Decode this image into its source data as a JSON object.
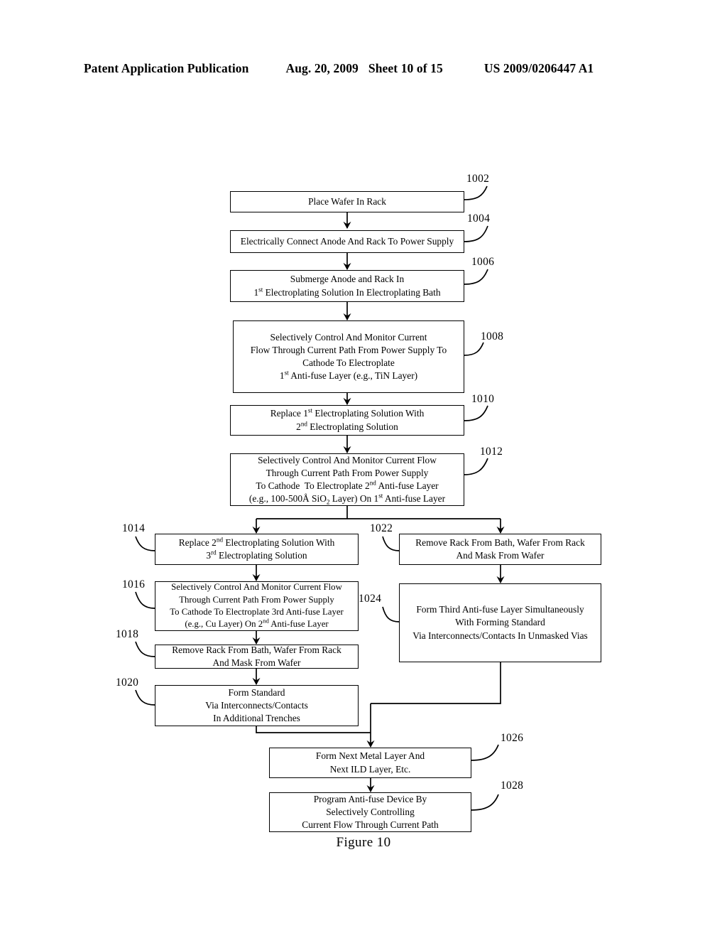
{
  "header": {
    "publication": "Patent Application Publication",
    "date": "Aug. 20, 2009",
    "sheet": "Sheet 10 of 15",
    "patent_number": "US 2009/0206447 A1"
  },
  "figure": {
    "caption": "Figure 10"
  },
  "colors": {
    "ink": "#000000",
    "paper": "#ffffff"
  },
  "flowchart": {
    "type": "process-flow-diagram",
    "nodes": [
      {
        "ref": "1002",
        "lines": [
          "Place Wafer In Rack"
        ]
      },
      {
        "ref": "1004",
        "lines": [
          "Electrically Connect Anode And Rack To Power Supply"
        ]
      },
      {
        "ref": "1006",
        "lines": [
          "Submerge Anode and Rack In",
          "1st Electroplating Solution In Electroplating Bath"
        ]
      },
      {
        "ref": "1008",
        "lines": [
          "Selectively Control And Monitor Current",
          "Flow Through Current Path From Power Supply To",
          "Cathode To Electroplate",
          "1st Anti-fuse Layer (e.g., TiN Layer)"
        ]
      },
      {
        "ref": "1010",
        "lines": [
          "Replace 1st Electroplating Solution With",
          "2nd Electroplating Solution"
        ]
      },
      {
        "ref": "1012",
        "lines": [
          "Selectively Control And Monitor Current Flow",
          "Through Current Path From Power Supply",
          "To Cathode  To Electroplate 2nd Anti-fuse Layer",
          "(e.g., 100-500Å SiO2 Layer) On 1st Anti-fuse Layer"
        ]
      },
      {
        "ref": "1014",
        "lines": [
          "Replace 2nd Electroplating Solution With",
          "3rd Electroplating Solution"
        ]
      },
      {
        "ref": "1016",
        "lines": [
          "Selectively Control And Monitor Current Flow",
          "Through Current Path From Power Supply",
          "To Cathode To Electroplate 3rd Anti-fuse Layer",
          "(e.g., Cu Layer) On 2nd Anti-fuse Layer"
        ]
      },
      {
        "ref": "1018",
        "lines": [
          "Remove Rack From Bath, Wafer From Rack",
          "And Mask From Wafer"
        ]
      },
      {
        "ref": "1020",
        "lines": [
          "Form Standard",
          "Via Interconnects/Contacts",
          "In Additional Trenches"
        ]
      },
      {
        "ref": "1022",
        "lines": [
          "Remove Rack From Bath, Wafer From Rack",
          "And Mask From Wafer"
        ]
      },
      {
        "ref": "1024",
        "lines": [
          "Form Third Anti-fuse Layer Simultaneously",
          "With Forming Standard",
          "Via Interconnects/Contacts In Unmasked Vias"
        ]
      },
      {
        "ref": "1026",
        "lines": [
          "Form Next Metal Layer And",
          "Next ILD Layer, Etc."
        ]
      },
      {
        "ref": "1028",
        "lines": [
          "Program Anti-fuse Device By",
          "Selectively Controlling",
          "Current Flow Through Current Path"
        ]
      }
    ]
  }
}
